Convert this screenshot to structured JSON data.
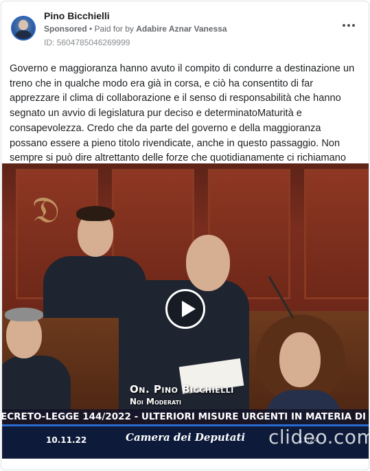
{
  "ad": {
    "page_name": "Pino Bicchielli",
    "sponsored_label": "Sponsored",
    "separator": " • ",
    "paid_for_prefix": "Paid for by ",
    "paid_for_name": "Adabire Aznar Vanessa",
    "id_text": "ID: 5604785046269999",
    "more_icon": "more-options-icon"
  },
  "post": {
    "text": "Governo e maggioranza hanno avuto il compito di condurre a destinazione un treno che in qualche modo era già in corsa, e ciò ha consentito di far apprezzare il clima di collaborazione e il senso di responsabilità che hanno segnato un avvio di legislatura pur deciso e determinatoMaturità e consapevolezza. Credo che da parte del governo e della maggioranza possano essere a pieno titolo rivendicate, anche in questo passaggio. Non sempre si può dire altrettanto delle forze che quotidianamente ci richiamano alla serietà, ritenendosene dispensatori, e poi si..."
  },
  "video": {
    "speaker_name": "On. Pino Bicchielli",
    "speaker_party": "Noi Moderati",
    "ticker": "ECRETO-LEGGE 144/2022 - ULTERIORI MISURE URGENTI IN MATERIA DI",
    "date": "10.11.22",
    "channel": "Camera dei Deputati",
    "watermark": "clideo.com",
    "timecode": "11:24",
    "play_icon": "play-icon"
  }
}
